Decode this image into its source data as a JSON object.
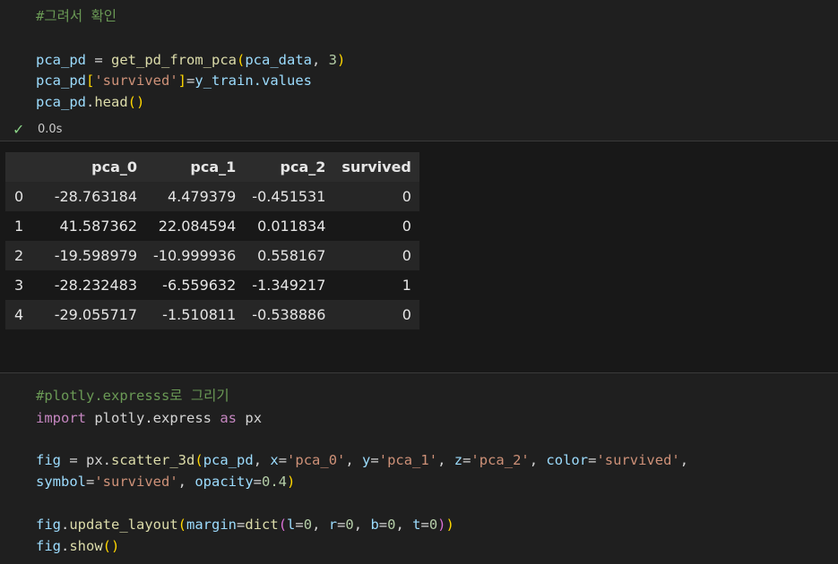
{
  "cell1": {
    "comment": "#그려서 확인",
    "line2_var": "pca_pd",
    "line2_fn": "get_pd_from_pca",
    "line2_arg1": "pca_data",
    "line2_arg2": "3",
    "line3_var": "pca_pd",
    "line3_key": "'survived'",
    "line3_rhs": "y_train.values",
    "line4_var": "pca_pd",
    "line4_fn": "head",
    "status_time": "0.0s"
  },
  "dataframe": {
    "columns": [
      "pca_0",
      "pca_1",
      "pca_2",
      "survived"
    ],
    "rows": [
      {
        "index": "0",
        "values": [
          "-28.763184",
          "4.479379",
          "-0.451531",
          "0"
        ]
      },
      {
        "index": "1",
        "values": [
          "41.587362",
          "22.084594",
          "0.011834",
          "0"
        ]
      },
      {
        "index": "2",
        "values": [
          "-19.598979",
          "-10.999936",
          "0.558167",
          "0"
        ]
      },
      {
        "index": "3",
        "values": [
          "-28.232483",
          "-6.559632",
          "-1.349217",
          "1"
        ]
      },
      {
        "index": "4",
        "values": [
          "-29.055717",
          "-1.510811",
          "-0.538886",
          "0"
        ]
      }
    ]
  },
  "cell2": {
    "comment": "#plotly.expresss로 그리기",
    "import_kw": "import",
    "module": "plotly.express",
    "as_kw": "as",
    "alias": "px",
    "fig_var": "fig",
    "scatter_fn": "scatter_3d",
    "df_arg": "pca_pd",
    "x_val": "'pca_0'",
    "y_val": "'pca_1'",
    "z_val": "'pca_2'",
    "color_val": "'survived'",
    "symbol_val": "'survived'",
    "opacity_val": "0.4",
    "update_fn": "update_layout",
    "dict_fn": "dict",
    "show_fn": "show"
  },
  "colors": {
    "background": "#1f1f1f",
    "output_background": "#181818",
    "comment": "#6a9955",
    "keyword": "#c586c0",
    "function": "#dcdcaa",
    "variable": "#9cdcfe",
    "string": "#ce9178",
    "number": "#b5cea8",
    "success": "#89d185"
  },
  "icons": {
    "status": "check-icon"
  }
}
